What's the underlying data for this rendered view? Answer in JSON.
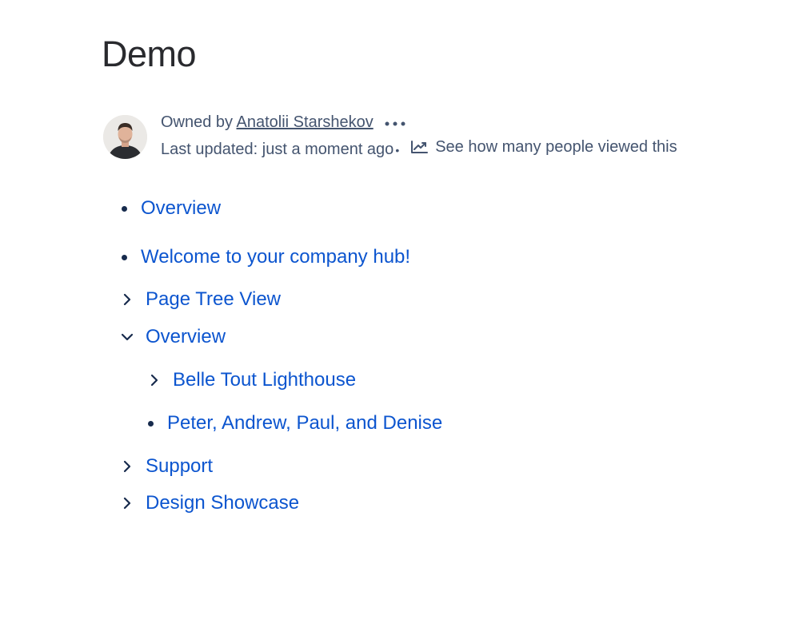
{
  "page": {
    "title": "Demo"
  },
  "byline": {
    "owned_by_prefix": "Owned by ",
    "owner_name": "Anatolii Starshekov",
    "last_updated": "Last updated: just a moment ago",
    "separator": "•",
    "analytics_label": "See how many people viewed this",
    "more_icon": "more-horizontal-icon",
    "analytics_icon": "line-chart-icon"
  },
  "content": {
    "bullets": [
      {
        "label": "Overview"
      },
      {
        "label": "Welcome to your company hub!"
      }
    ],
    "tree": [
      {
        "label": "Page Tree View",
        "state": "collapsed"
      },
      {
        "label": "Overview",
        "state": "expanded"
      },
      {
        "label": "Belle Tout Lighthouse",
        "state": "collapsed"
      },
      {
        "label": "Peter, Andrew, Paul, and Denise",
        "state": "leaf"
      },
      {
        "label": "Support",
        "state": "collapsed"
      },
      {
        "label": "Design Showcase",
        "state": "collapsed"
      }
    ]
  },
  "colors": {
    "link": "#0c55cf",
    "byline_text": "#44546f",
    "title_text": "#292a2e"
  }
}
